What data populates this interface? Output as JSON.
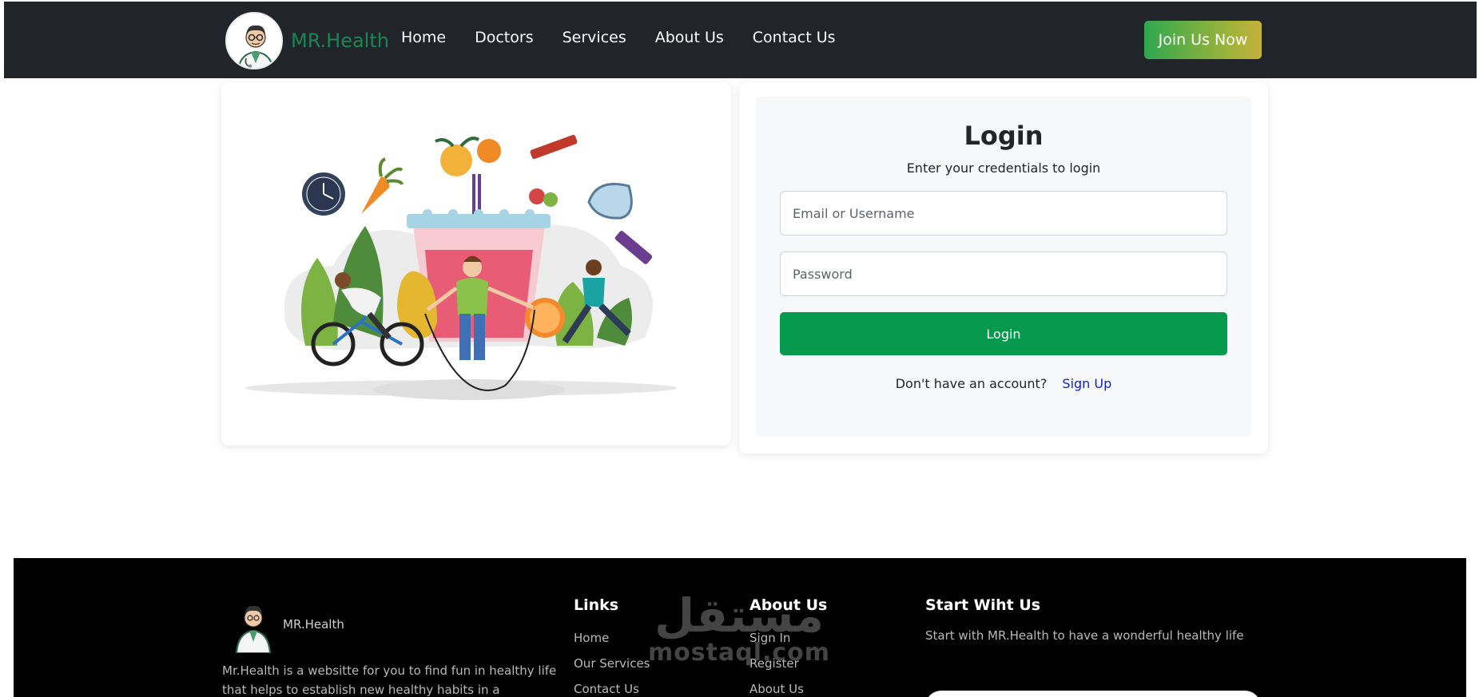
{
  "nav": {
    "brand": "MR.Health",
    "links": [
      "Home",
      "Doctors",
      "Services",
      "About Us",
      "Contact Us"
    ],
    "join_label": "Join Us Now"
  },
  "login": {
    "title": "Login",
    "subtitle": "Enter your credentials to login",
    "email_placeholder": "Email or Username",
    "password_placeholder": "Password",
    "button_label": "Login",
    "no_account_text": "Don't have an account?",
    "signup_label": "Sign Up"
  },
  "footer": {
    "brand": "MR.Health",
    "description": "Mr.Health is a websitte for you to find fun in healthy life that helps to establish new healthy habits in a",
    "links_heading": "Links",
    "links": [
      "Home",
      "Our Services",
      "Contact Us"
    ],
    "about_heading": "About Us",
    "about_links": [
      "Sign In",
      "Register",
      "About Us"
    ],
    "start_heading": "Start Wiht Us",
    "start_text": "Start with MR.Health to have a wonderful healthy life"
  },
  "watermark": {
    "arabic": "مستقل",
    "latin": "mostaql.com"
  },
  "colors": {
    "navbar_bg": "#212529",
    "brand_green": "#198754",
    "login_button": "#079a4e",
    "signup_link": "#0d1de0",
    "footer_bg": "#000000"
  }
}
